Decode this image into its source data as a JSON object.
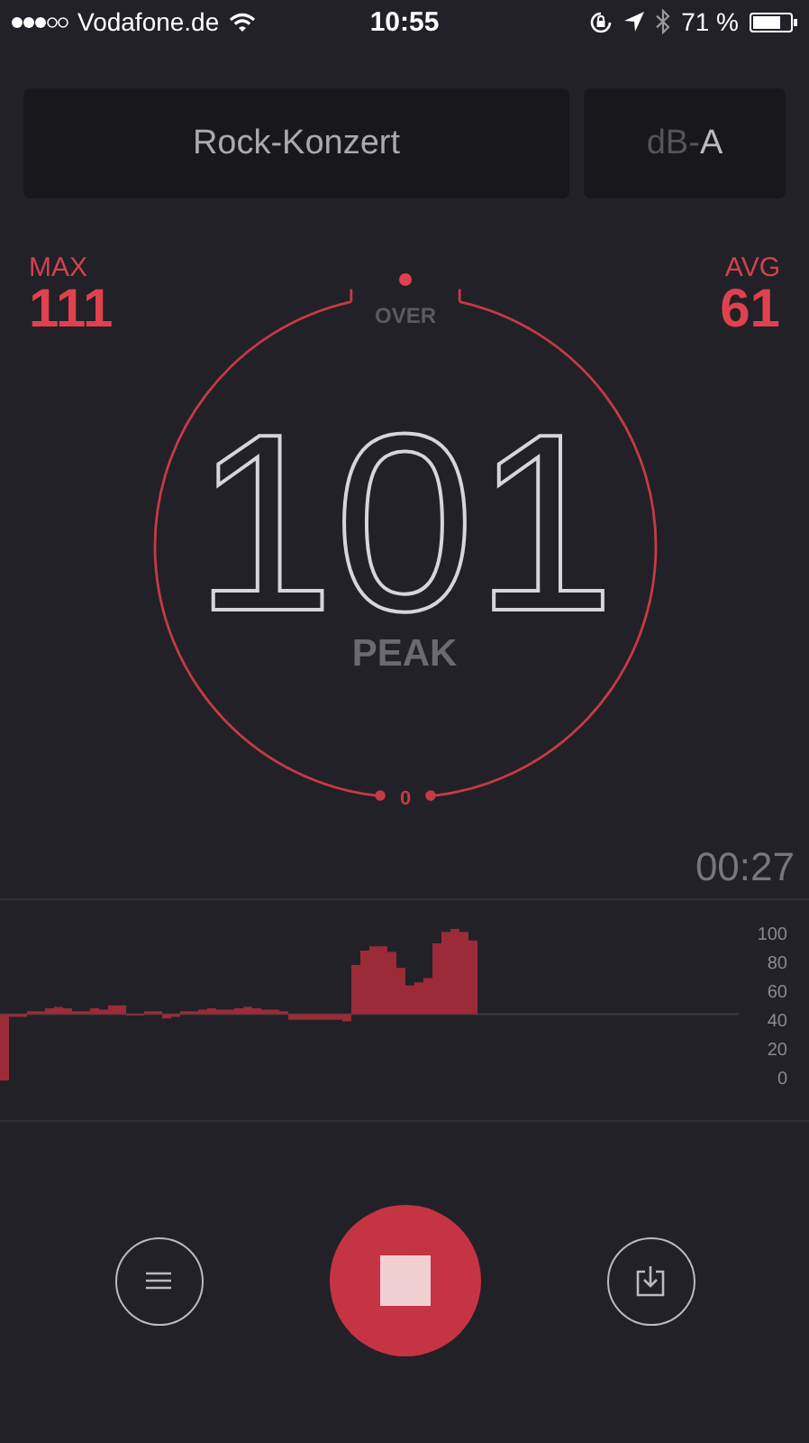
{
  "status_bar": {
    "carrier": "Vodafone.de",
    "time": "10:55",
    "battery_percent": "71 %"
  },
  "preset": {
    "label": "Rock-Konzert"
  },
  "weighting": {
    "prefix": "dB-",
    "value": "A"
  },
  "stats": [
    {
      "label": "MAX",
      "value": "111"
    },
    {
      "label": "AVG",
      "value": "61"
    }
  ],
  "gauge": {
    "top_label": "OVER",
    "bottom_label": "0",
    "reading": "101",
    "mode": "PEAK"
  },
  "elapsed": "00:27",
  "level_axis": [
    "100",
    "80",
    "60",
    "40",
    "20",
    "0"
  ]
}
